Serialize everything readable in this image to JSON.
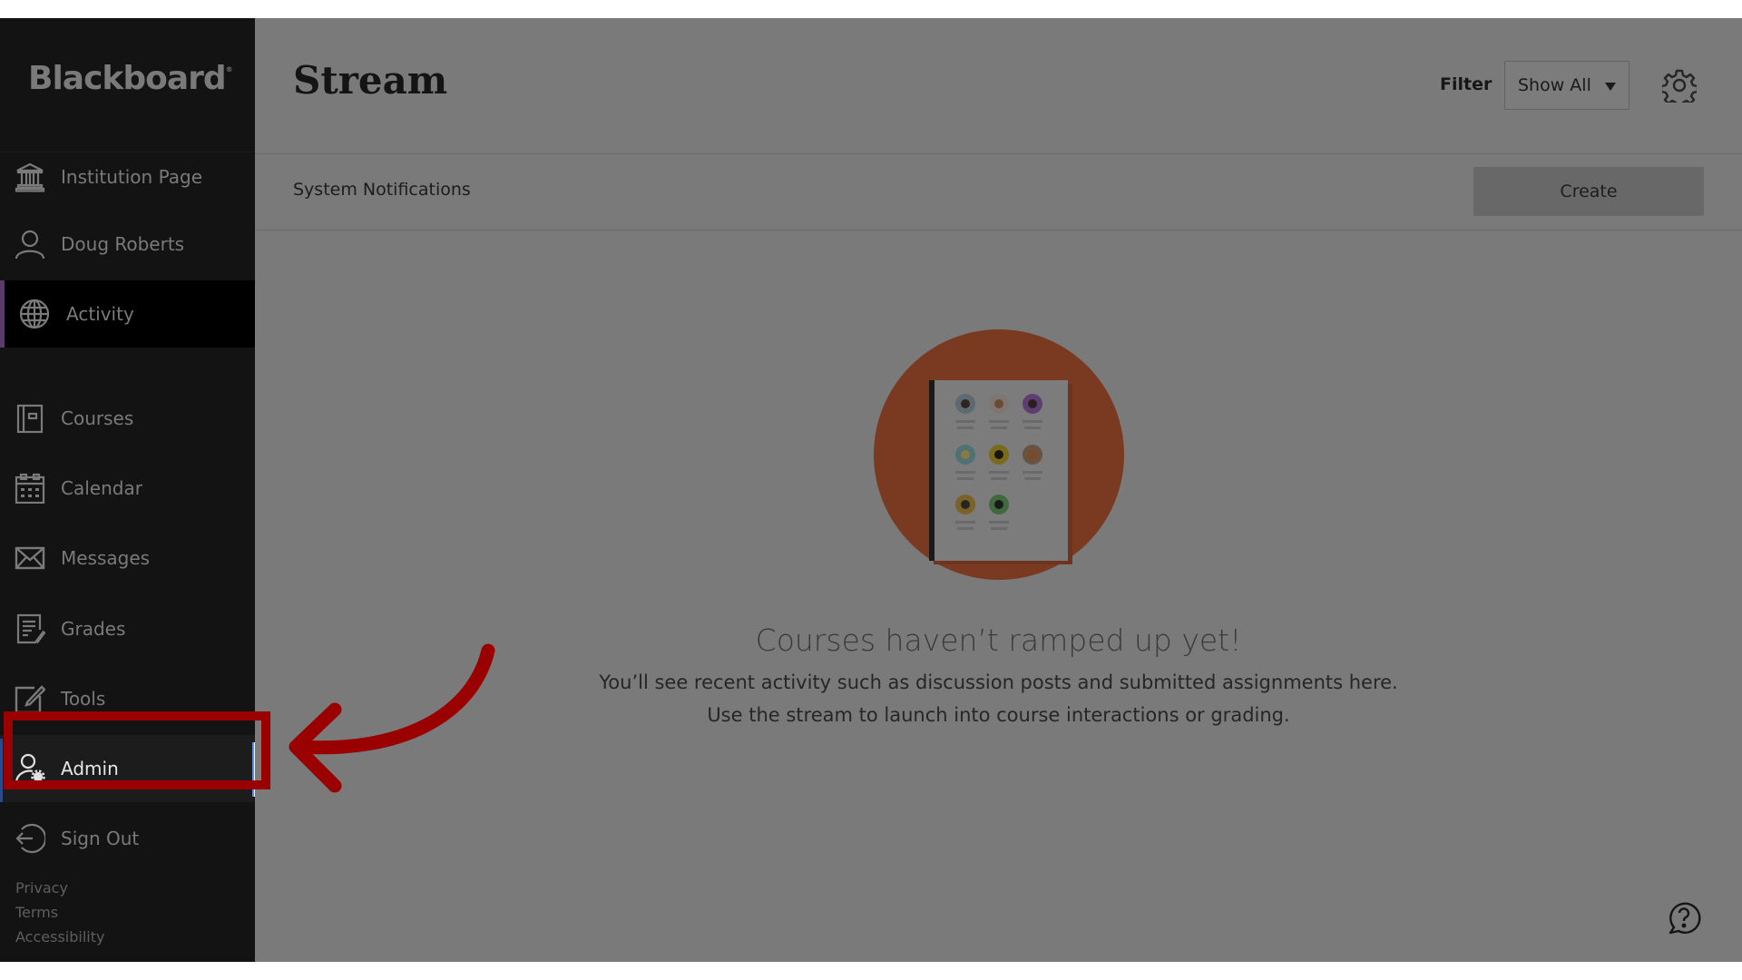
{
  "brand": {
    "logo_text": "Blackboard",
    "trademark": "®"
  },
  "sidebar": {
    "items": [
      {
        "id": "institution-page",
        "label": "Institution Page",
        "icon": "institution-icon"
      },
      {
        "id": "profile",
        "label": "Doug Roberts",
        "icon": "user-icon"
      },
      {
        "id": "activity",
        "label": "Activity",
        "icon": "globe-icon",
        "active": true
      },
      {
        "id": "courses",
        "label": "Courses",
        "icon": "courses-icon"
      },
      {
        "id": "calendar",
        "label": "Calendar",
        "icon": "calendar-icon"
      },
      {
        "id": "messages",
        "label": "Messages",
        "icon": "envelope-icon"
      },
      {
        "id": "grades",
        "label": "Grades",
        "icon": "grades-icon"
      },
      {
        "id": "tools",
        "label": "Tools",
        "icon": "tools-icon"
      },
      {
        "id": "admin",
        "label": "Admin",
        "icon": "admin-icon",
        "highlighted": true
      },
      {
        "id": "sign-out",
        "label": "Sign Out",
        "icon": "sign-out-icon"
      }
    ],
    "footer_links": [
      "Privacy",
      "Terms",
      "Accessibility"
    ]
  },
  "header": {
    "title": "Stream",
    "filter_label": "Filter",
    "filter_value": "Show All",
    "settings_icon": "gear-icon"
  },
  "notifications": {
    "label": "System Notifications",
    "create_label": "Create"
  },
  "empty_state": {
    "title": "Courses haven’t ramped up yet!",
    "line1": "You’ll see recent activity such as discussion posts and submitted assignments here.",
    "line2": "Use the stream to launch into course interactions or grading.",
    "illustration": "class-roster-document",
    "circle_color": "#7a3a22"
  },
  "help_icon": "help-chat-icon",
  "annotation": {
    "color": "#9b0000",
    "target": "Admin"
  },
  "colors": {
    "sidebar_bg": "#131313",
    "main_bg": "#7a7a7a",
    "active_accent": "#5a3a68"
  }
}
